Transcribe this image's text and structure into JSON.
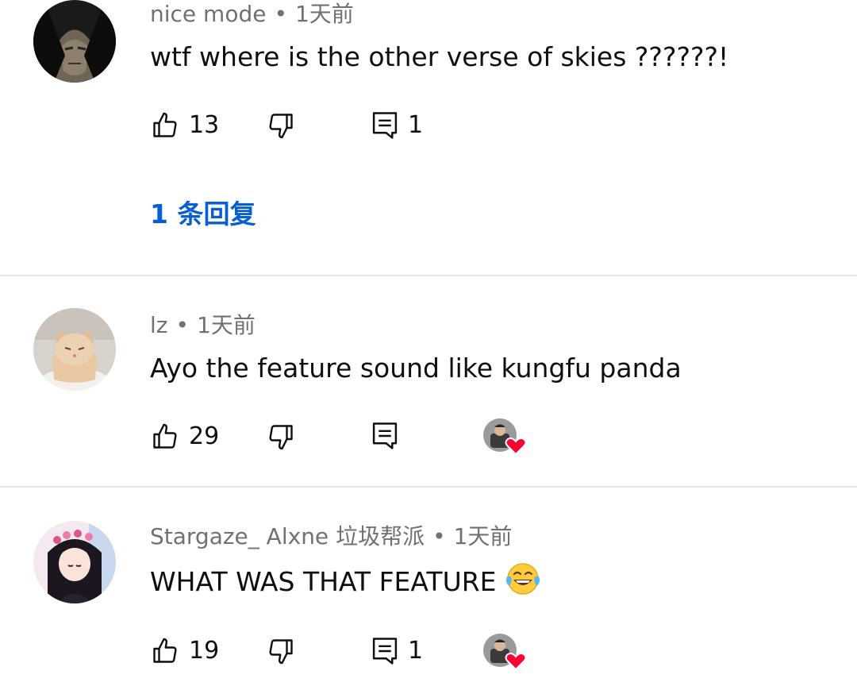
{
  "comments": [
    {
      "author": "nice mode",
      "separator": "•",
      "time": "1天前",
      "text": "wtf where is the other verse of skies ??????!",
      "likes": "13",
      "replies_count": "1",
      "replies_link": "1 条回复"
    },
    {
      "author": "lz",
      "separator": "•",
      "time": "1天前",
      "text": "Ayo the feature sound like kungfu panda",
      "likes": "29",
      "replies_count": ""
    },
    {
      "author": "Stargaze_ Alxne 垃圾帮派",
      "separator": "•",
      "time": "1天前",
      "text": "WHAT WAS THAT FEATURE",
      "emoji": "joy-emoji",
      "likes": "19",
      "replies_count": "1"
    }
  ],
  "icons": {
    "like": "thumbs-up-outline-icon",
    "dislike": "thumbs-down-outline-icon",
    "reply": "comment-reply-icon",
    "creator_heart": "creator-heart-icon"
  },
  "colors": {
    "link_blue": "#065fd4",
    "meta_gray": "#717171",
    "text": "#0f0f0f",
    "divider": "#e5e5e5",
    "heart_red": "#ff0033"
  }
}
